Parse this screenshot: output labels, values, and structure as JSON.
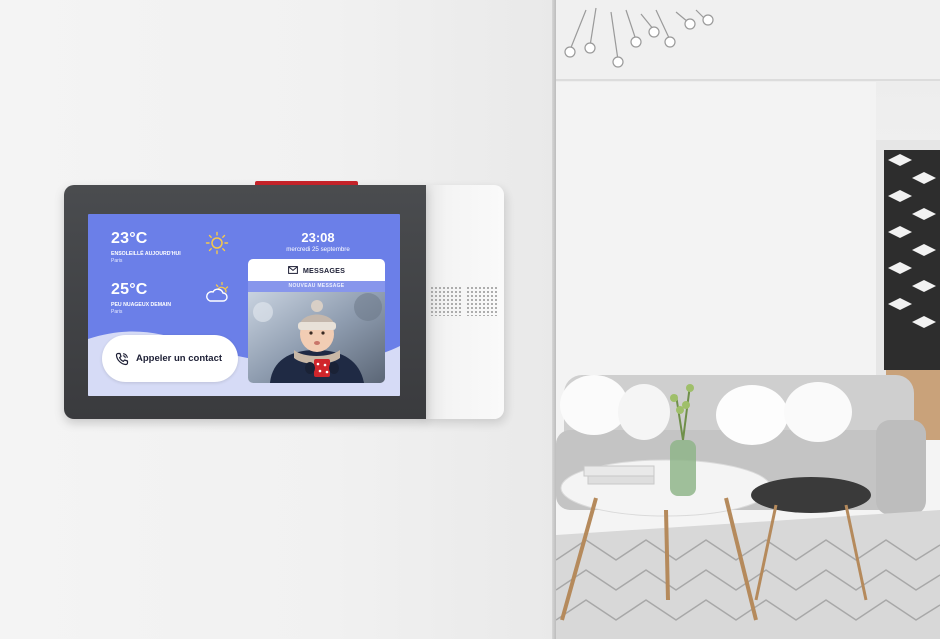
{
  "weather": [
    {
      "temp": "23°C",
      "condition": "ENSOLEILLÉ AUJOURD'HUI",
      "city": "Paris",
      "icon": "sun-icon"
    },
    {
      "temp": "25°C",
      "condition": "PEU NUAGEUX DEMAIN",
      "city": "Paris",
      "icon": "partly-cloudy-icon"
    }
  ],
  "clock": {
    "time": "23:08",
    "date": "mercredi 25 septembre"
  },
  "call": {
    "label": "Appeler un contact",
    "icon": "phone-icon"
  },
  "messages": {
    "title": "MESSAGES",
    "band": "NOUVEAU MESSAGE",
    "icon": "envelope-icon"
  },
  "colors": {
    "screen_bg": "#6b7fe8",
    "accent_red": "#c8242b",
    "band": "#8796ec"
  }
}
